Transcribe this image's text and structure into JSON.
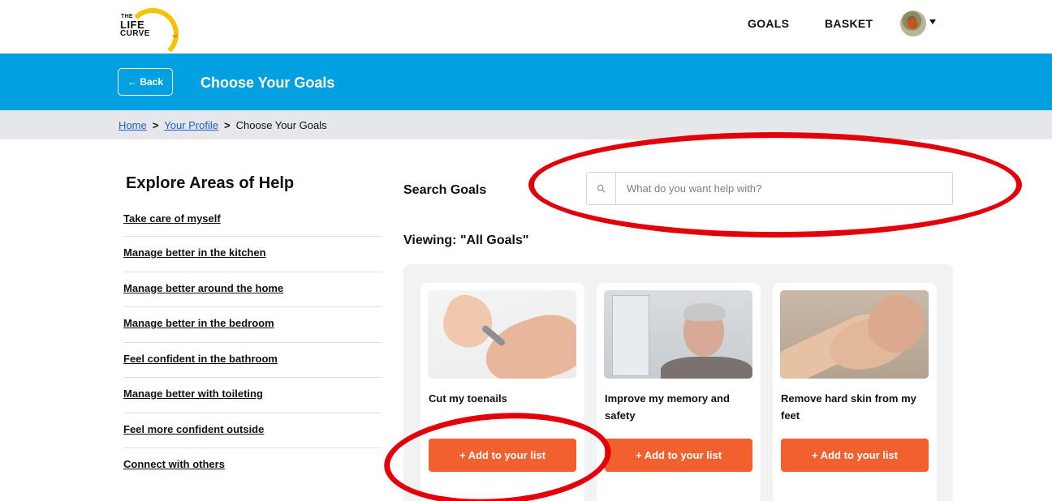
{
  "logo": {
    "line1": "THE",
    "line2": "LIFE",
    "line3": "CURVE",
    "tm": "TM"
  },
  "topnav": {
    "goals": "GOALS",
    "basket": "BASKET",
    "avatar_icon": "user-avatar-bird"
  },
  "banner": {
    "back": "← Back",
    "title": "Choose Your Goals"
  },
  "breadcrumb": {
    "home": "Home",
    "profile": "Your Profile",
    "current": "Choose Your Goals",
    "sep": ">"
  },
  "sidebar": {
    "title": "Explore Areas of Help",
    "items": [
      {
        "label": "Take care of myself"
      },
      {
        "label": "Manage better in the kitchen"
      },
      {
        "label": "Manage better around the home"
      },
      {
        "label": "Manage better in the bedroom"
      },
      {
        "label": "Feel confident in the bathroom"
      },
      {
        "label": "Manage better with toileting"
      },
      {
        "label": "Feel more confident outside"
      },
      {
        "label": "Connect with others"
      }
    ]
  },
  "search": {
    "label": "Search Goals",
    "placeholder": "What do you want help with?",
    "value": ""
  },
  "viewing": "Viewing: \"All Goals\"",
  "goals": [
    {
      "title": "Cut my toenails",
      "button": "+ Add to your list"
    },
    {
      "title": "Improve my memory and safety",
      "button": "+ Add to your list"
    },
    {
      "title": "Remove hard skin from my feet",
      "button": "+ Add to your list"
    }
  ],
  "colors": {
    "banner": "#00a0e1",
    "accent_button": "#f2602d",
    "annotation": "#e3000b",
    "link": "#1d5fcf"
  }
}
